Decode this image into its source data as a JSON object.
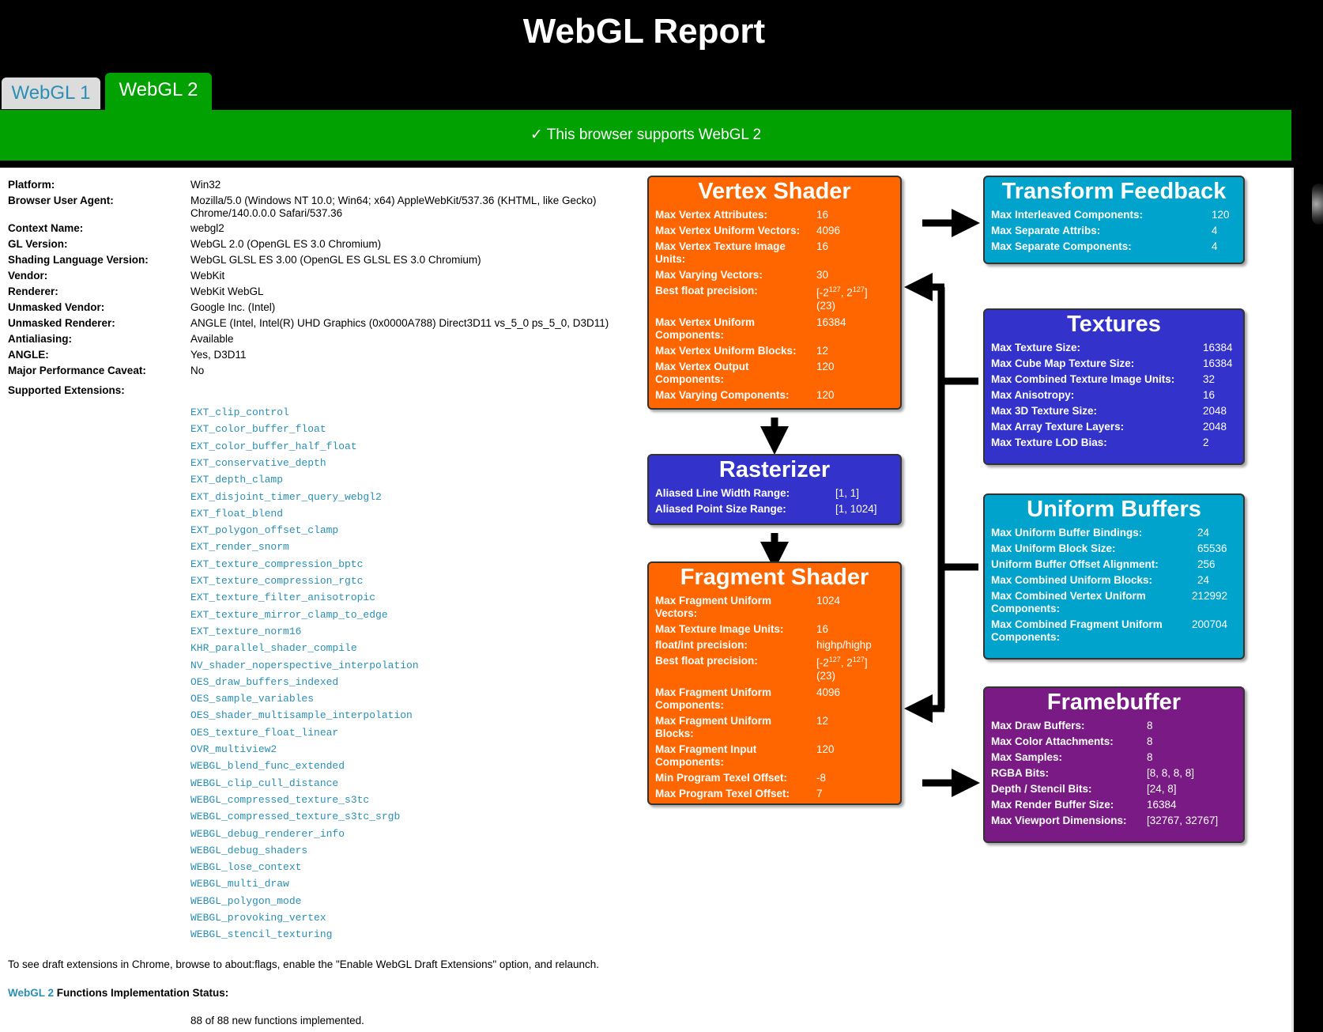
{
  "page_title": "WebGL Report",
  "tabs": [
    {
      "label": "WebGL 1",
      "active": false
    },
    {
      "label": "WebGL 2",
      "active": true
    }
  ],
  "banner": "✓ This browser supports WebGL 2",
  "colors": {
    "green": "#00a100",
    "link": "#2a8fb5",
    "orange": "#ff6600",
    "blue": "#3333cc",
    "cyan": "#00a3cc",
    "purple": "#7a1a85"
  },
  "info": [
    {
      "label": "Platform:",
      "value": "Win32"
    },
    {
      "label": "Browser User Agent:",
      "value": "Mozilla/5.0 (Windows NT 10.0; Win64; x64) AppleWebKit/537.36 (KHTML, like Gecko) Chrome/140.0.0.0 Safari/537.36"
    },
    {
      "label": "Context Name:",
      "value": "webgl2"
    },
    {
      "label": "GL Version:",
      "value": "WebGL 2.0 (OpenGL ES 3.0 Chromium)"
    },
    {
      "label": "Shading Language Version:",
      "value": "WebGL GLSL ES 3.00 (OpenGL ES GLSL ES 3.0 Chromium)"
    },
    {
      "label": "Vendor:",
      "value": "WebKit"
    },
    {
      "label": "Renderer:",
      "value": "WebKit WebGL"
    },
    {
      "label": "Unmasked Vendor:",
      "value": "Google Inc. (Intel)"
    },
    {
      "label": "Unmasked Renderer:",
      "value": "ANGLE (Intel, Intel(R) UHD Graphics (0x0000A788) Direct3D11 vs_5_0 ps_5_0, D3D11)"
    },
    {
      "label": "Antialiasing:",
      "value": "Available"
    },
    {
      "label": "ANGLE:",
      "value": "Yes, D3D11"
    },
    {
      "label": "Major Performance Caveat:",
      "value": "No"
    }
  ],
  "extensions_label": "Supported Extensions:",
  "extensions": [
    "EXT_clip_control",
    "EXT_color_buffer_float",
    "EXT_color_buffer_half_float",
    "EXT_conservative_depth",
    "EXT_depth_clamp",
    "EXT_disjoint_timer_query_webgl2",
    "EXT_float_blend",
    "EXT_polygon_offset_clamp",
    "EXT_render_snorm",
    "EXT_texture_compression_bptc",
    "EXT_texture_compression_rgtc",
    "EXT_texture_filter_anisotropic",
    "EXT_texture_mirror_clamp_to_edge",
    "EXT_texture_norm16",
    "KHR_parallel_shader_compile",
    "NV_shader_noperspective_interpolation",
    "OES_draw_buffers_indexed",
    "OES_sample_variables",
    "OES_shader_multisample_interpolation",
    "OES_texture_float_linear",
    "OVR_multiview2",
    "WEBGL_blend_func_extended",
    "WEBGL_clip_cull_distance",
    "WEBGL_compressed_texture_s3tc",
    "WEBGL_compressed_texture_s3tc_srgb",
    "WEBGL_debug_renderer_info",
    "WEBGL_debug_shaders",
    "WEBGL_lose_context",
    "WEBGL_multi_draw",
    "WEBGL_polygon_mode",
    "WEBGL_provoking_vertex",
    "WEBGL_stencil_texturing"
  ],
  "draft_note": "To see draft extensions in Chrome, browse to about:flags, enable the \"Enable WebGL Draft Extensions\" option, and relaunch.",
  "functions_link": "WebGL 2",
  "functions_label": " Functions Implementation Status:",
  "functions_status": "88 of 88 new functions implemented.",
  "boxes": {
    "vertex": {
      "title": "Vertex Shader",
      "rows": [
        {
          "k": "Max Vertex Attributes:",
          "v": "16"
        },
        {
          "k": "Max Vertex Uniform Vectors:",
          "v": "4096"
        },
        {
          "k": "Max Vertex Texture Image Units:",
          "v": "16"
        },
        {
          "k": "Max Varying Vectors:",
          "v": "30"
        },
        {
          "k": "Best float precision:",
          "v": "[-2127, 2127] (23)"
        },
        {
          "k": "Max Vertex Uniform Components:",
          "v": "16384"
        },
        {
          "k": "Max Vertex Uniform Blocks:",
          "v": "12"
        },
        {
          "k": "Max Vertex Output Components:",
          "v": "120"
        },
        {
          "k": "Max Varying Components:",
          "v": "120"
        }
      ]
    },
    "rasterizer": {
      "title": "Rasterizer",
      "rows": [
        {
          "k": "Aliased Line Width Range:",
          "v": "[1, 1]"
        },
        {
          "k": "Aliased Point Size Range:",
          "v": "[1, 1024]"
        }
      ]
    },
    "fragment": {
      "title": "Fragment Shader",
      "rows": [
        {
          "k": "Max Fragment Uniform Vectors:",
          "v": "1024"
        },
        {
          "k": "Max Texture Image Units:",
          "v": "16"
        },
        {
          "k": "float/int precision:",
          "v": "highp/highp"
        },
        {
          "k": "Best float precision:",
          "v": "[-2127, 2127] (23)"
        },
        {
          "k": "Max Fragment Uniform Components:",
          "v": "4096"
        },
        {
          "k": "Max Fragment Uniform Blocks:",
          "v": "12"
        },
        {
          "k": "Max Fragment Input Components:",
          "v": "120"
        },
        {
          "k": "Min Program Texel Offset:",
          "v": "-8"
        },
        {
          "k": "Max Program Texel Offset:",
          "v": "7"
        }
      ]
    },
    "transform": {
      "title": "Transform Feedback",
      "rows": [
        {
          "k": "Max Interleaved Components:",
          "v": "120"
        },
        {
          "k": "Max Separate Attribs:",
          "v": "4"
        },
        {
          "k": "Max Separate Components:",
          "v": "4"
        }
      ]
    },
    "textures": {
      "title": "Textures",
      "rows": [
        {
          "k": "Max Texture Size:",
          "v": "16384"
        },
        {
          "k": "Max Cube Map Texture Size:",
          "v": "16384"
        },
        {
          "k": "Max Combined Texture Image Units:",
          "v": "32"
        },
        {
          "k": "Max Anisotropy:",
          "v": "16"
        },
        {
          "k": "Max 3D Texture Size:",
          "v": "2048"
        },
        {
          "k": "Max Array Texture Layers:",
          "v": "2048"
        },
        {
          "k": "Max Texture LOD Bias:",
          "v": "2"
        }
      ]
    },
    "uniform": {
      "title": "Uniform Buffers",
      "rows": [
        {
          "k": "Max Uniform Buffer Bindings:",
          "v": "24"
        },
        {
          "k": "Max Uniform Block Size:",
          "v": "65536"
        },
        {
          "k": "Uniform Buffer Offset Alignment:",
          "v": "256"
        },
        {
          "k": "Max Combined Uniform Blocks:",
          "v": "24"
        },
        {
          "k": "Max Combined Vertex Uniform Components:",
          "v": "212992"
        },
        {
          "k": "Max Combined Fragment Uniform Components:",
          "v": "200704"
        }
      ]
    },
    "framebuffer": {
      "title": "Framebuffer",
      "rows": [
        {
          "k": "Max Draw Buffers:",
          "v": "8"
        },
        {
          "k": "Max Color Attachments:",
          "v": "8"
        },
        {
          "k": "Max Samples:",
          "v": "8"
        },
        {
          "k": "RGBA Bits:",
          "v": "[8, 8, 8, 8]"
        },
        {
          "k": "Depth / Stencil Bits:",
          "v": "[24, 8]"
        },
        {
          "k": "Max Render Buffer Size:",
          "v": "16384"
        },
        {
          "k": "Max Viewport Dimensions:",
          "v": "[32767, 32767]"
        }
      ]
    }
  }
}
